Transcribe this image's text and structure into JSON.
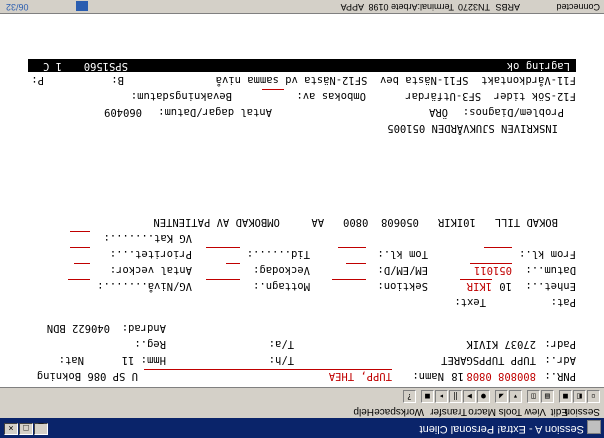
{
  "window": {
    "title": "Session A - Extra! Personal Client"
  },
  "menu": [
    "Session",
    "Edit",
    "View",
    "Tools",
    "Macro",
    "Transfer",
    "Workspace",
    "Help"
  ],
  "status": {
    "left": "Connected",
    "items": [
      "ARBS",
      "TN3270",
      "Terminal:Arbete 0198",
      "APPA"
    ],
    "page": "06/32"
  },
  "terminal": {
    "pnr_label": "PNR.:",
    "pnr": "800808 0808",
    "pnr_nr": "18",
    "namn_label": "Namn:",
    "namn": "TUPP, THEA",
    "u_sp": "U SP 086 Bokning",
    "adr_label": "Adr.:",
    "adr": "TUPP TUPPSGARET",
    "tn_label": "T/h:",
    "hmm_label": "Hmm: 11",
    "nat_label": "Nat:",
    "padr_label": "Padr:",
    "padr": "27037 KIVIK",
    "ta_label": "T/a:",
    "reg_label": "Reg.:",
    "andrad_label": "Andrad:",
    "andrad": "040622 BDN",
    "pat_label": "Pat:",
    "text_label": "Text:",
    "enhet_label": "Enhet..:",
    "enhet": "10",
    "enhet_val": "1KIR",
    "sektion_label": "Sektion:",
    "mottagn_label": "Mottagn.:",
    "vg_label": "VG/Nivå.......:",
    "datum_label": "Datum..:",
    "datum": "051011",
    "em_label": "EM/EM/D:",
    "veckodag_label": "Veckodag:",
    "antal_veckor_label": "Antal veckor:",
    "from_label": "From kl.:",
    "tom_label": "Tom kl.:",
    "tid_label": "Tid......:",
    "prio_label": "Prioritet...:",
    "vg_kat_label": "VG Kat.......:",
    "bokad_line": "BOKAD TILL   10IKIR   050608  0800   AA     OMBOKAD AV PATIENTEN",
    "inskriven_line": "INSKRIVEN SJUKVÅRDEN 051005",
    "problem_label": "Problem/Diagnos:",
    "problem": "ÖRA",
    "antal_dagar_label": "Antal dagar/Datum:",
    "antal_dagar": "060409",
    "f12_label": "F12-Sök tider  SF3-Utfärdar",
    "ombokas_label": "Ombokas av:",
    "bevakning_label": "Bevakningsdatum:",
    "f11_label": "F11-Vårdkontakt  SF11-Nästa bev  SF12-Nästa vd samma nivå",
    "b_label": "B:",
    "p_label": "P:",
    "msg": "Lagring ok",
    "msg_code": "SPS1560",
    "msg_flag": "1 C"
  }
}
